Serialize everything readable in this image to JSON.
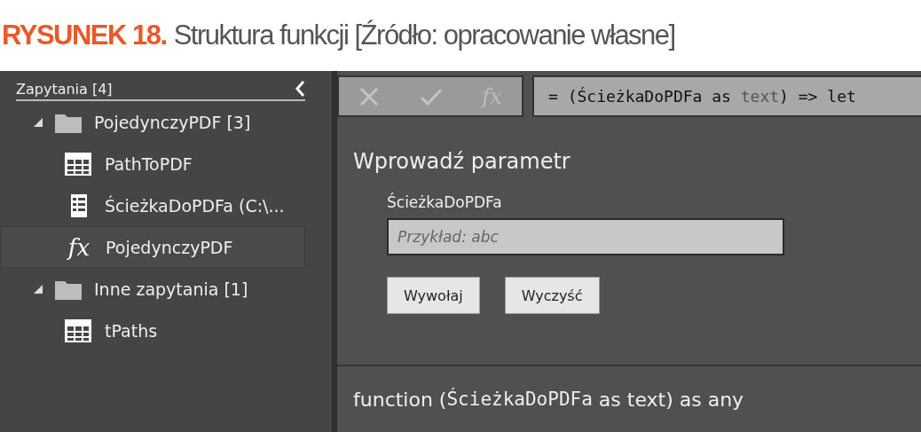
{
  "caption": {
    "label": "RYSUNEK 18.",
    "text": "Struktura funkcji [Źródło: opracowanie własne]"
  },
  "sidebar": {
    "title": "Zapytania [4]",
    "groups": [
      {
        "name": "PojedynczyPDF [3]",
        "expanded": true,
        "children": [
          {
            "kind": "table",
            "name": "PathToPDF",
            "selected": false
          },
          {
            "kind": "parameter",
            "name": "ŚcieżkaDoPDFa (C:\\...",
            "selected": false
          },
          {
            "kind": "function",
            "icon": "fx",
            "name": "PojedynczyPDF",
            "selected": true
          }
        ]
      },
      {
        "name": "Inne zapytania [1]",
        "expanded": true,
        "children": [
          {
            "kind": "table",
            "name": "tPaths",
            "selected": false
          }
        ]
      }
    ]
  },
  "formula_bar": {
    "function_button": "fx",
    "parts": [
      {
        "kind": "plain",
        "text": "= (ŚcieżkaDoPDFa as "
      },
      {
        "kind": "type",
        "text": "text"
      },
      {
        "kind": "plain",
        "text": ") => let"
      }
    ]
  },
  "parameter_form": {
    "title": "Wprowadź parametr",
    "label": "ŚcieżkaDoPDFa",
    "placeholder": "Przykład: abc",
    "buttons": [
      "Wywołaj",
      "Wyczyść"
    ]
  },
  "signature": {
    "parts": [
      {
        "kind": "plain",
        "text": "function ("
      },
      {
        "kind": "mono",
        "text": "ŚcieżkaDoPDFa"
      },
      {
        "kind": "plain",
        "text": " as text) as any"
      }
    ]
  }
}
